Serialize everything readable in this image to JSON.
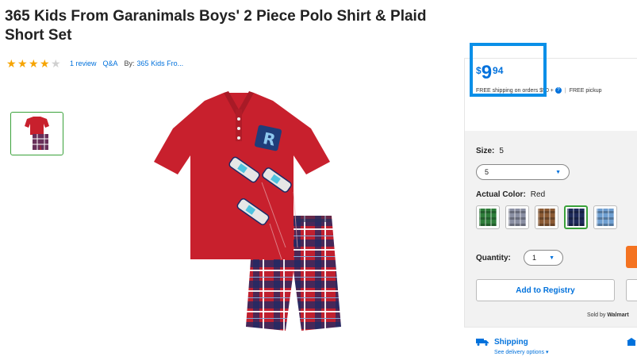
{
  "product": {
    "title": "365 Kids From Garanimals Boys' 2 Piece Polo Shirt & Plaid Short Set",
    "rating": 4,
    "rating_max": 5,
    "review_link": "1 review",
    "qa_link": "Q&A",
    "by_label": "By:",
    "brand_link": "365 Kids Fro..."
  },
  "price": {
    "currency": "$",
    "dollars": "9",
    "cents": "94",
    "shipping_note": "FREE shipping on orders $50 +",
    "pickup_note": "FREE pickup"
  },
  "options": {
    "size_label": "Size:",
    "size_value": "5",
    "size_selected": "5",
    "color_label": "Actual Color:",
    "color_value": "Red",
    "swatches": [
      {
        "name": "green plaid",
        "color": "#2e7d3a",
        "selected": false
      },
      {
        "name": "gray plaid",
        "color": "#8a8fa3",
        "selected": false
      },
      {
        "name": "brown plaid",
        "color": "#8b5a34",
        "selected": false
      },
      {
        "name": "navy plaid",
        "color": "#1e2a5a",
        "selected": true
      },
      {
        "name": "blue plaid",
        "color": "#6f9fd1",
        "selected": false
      }
    ],
    "quantity_label": "Quantity:",
    "quantity_value": "1"
  },
  "actions": {
    "registry_label": "Add to Registry"
  },
  "seller": {
    "sold_by_label": "Sold by",
    "sold_by_name": "Walmart"
  },
  "shipping": {
    "title": "Shipping",
    "sub": "See delivery options"
  },
  "colors": {
    "accent": "#0071dc",
    "highlight_box": "#0a8fe8",
    "star": "#f6a400",
    "selected_border": "#3aa13a",
    "cta": "#f47321"
  }
}
